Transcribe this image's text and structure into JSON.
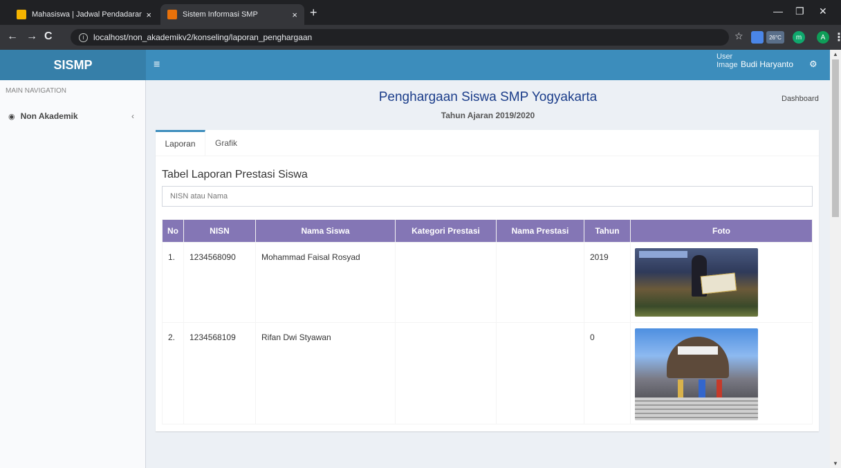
{
  "browser": {
    "tabs": [
      {
        "title": "Mahasiswa | Jadwal Pendadaran",
        "close": "×"
      },
      {
        "title": "Sistem Informasi SMP",
        "close": "×"
      }
    ],
    "new_tab": "+",
    "url": "localhost/non_akademikv2/konseling/laporan_penghargaan",
    "weather": "26°C",
    "profile_initial": "A",
    "ext_initial": "m"
  },
  "header": {
    "logo_bold": "SI",
    "logo_rest": "SMP",
    "user_image_alt": "User Image",
    "user_name": "Budi Haryanto"
  },
  "sidebar": {
    "header": "MAIN NAVIGATION",
    "items": [
      {
        "label": "Non Akademik"
      }
    ]
  },
  "page": {
    "title": "Penghargaan Siswa SMP Yogyakarta",
    "subtitle": "Tahun Ajaran 2019/2020",
    "breadcrumb": "Dashboard"
  },
  "tabs": [
    {
      "label": "Laporan",
      "active": true
    },
    {
      "label": "Grafik",
      "active": false
    }
  ],
  "table": {
    "heading": "Tabel Laporan Prestasi Siswa",
    "search_placeholder": "NISN atau Nama",
    "columns": [
      "No",
      "NISN",
      "Nama Siswa",
      "Kategori Prestasi",
      "Nama Prestasi",
      "Tahun",
      "Foto"
    ],
    "rows": [
      {
        "no": "1.",
        "nisn": "1234568090",
        "nama": "Mohammad Faisal Rosyad",
        "kategori": "",
        "prestasi": "",
        "tahun": "2019",
        "foto": "award-photo"
      },
      {
        "no": "2.",
        "nisn": "1234568109",
        "nama": "Rifan Dwi Styawan",
        "kategori": "",
        "prestasi": "",
        "tahun": "0",
        "foto": "event-photo"
      }
    ]
  },
  "colors": {
    "header": "#3c8dbc",
    "logo": "#367fa9",
    "table_header": "#8476b5",
    "title": "#1b3d8a"
  }
}
